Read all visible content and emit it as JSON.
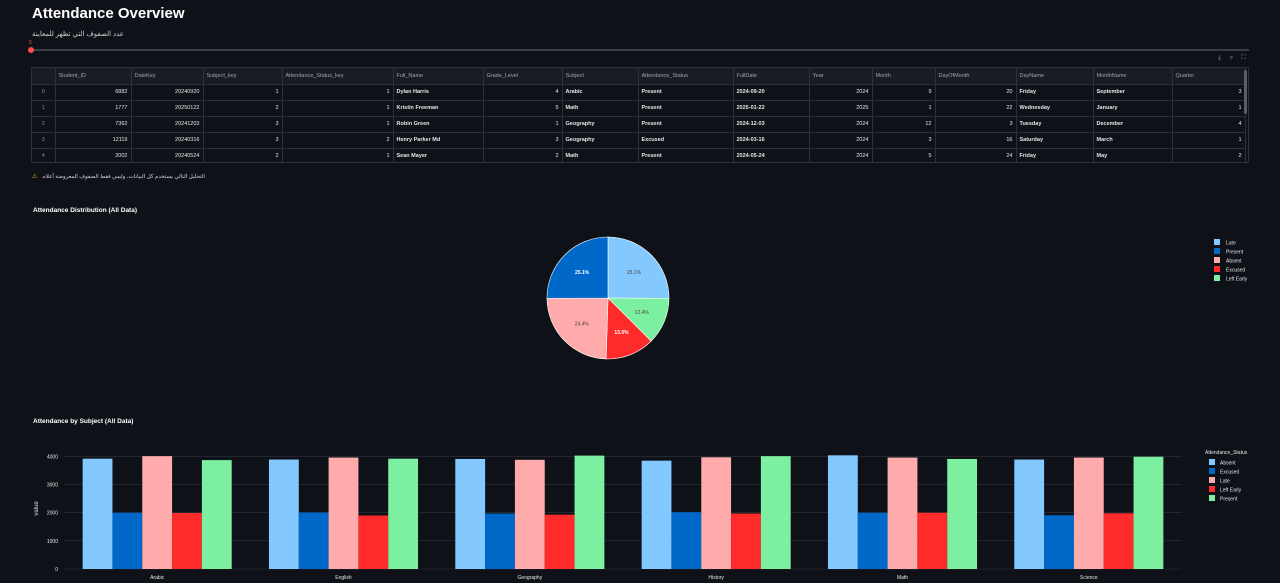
{
  "page": {
    "title": "Attendance Overview"
  },
  "slider": {
    "label": "عدد الصفوف التي تظهر للمعاينة",
    "value": "5"
  },
  "toolbar": {
    "download_icon": "download-icon",
    "search_icon": "search-icon",
    "fullscreen_icon": "fullscreen-icon"
  },
  "table": {
    "columns": [
      "",
      "Student_ID",
      "DateKey",
      "Subject_key",
      "Attendance_Status_key",
      "Full_Name",
      "Grade_Level",
      "Subject",
      "Attendance_Status",
      "FullDate",
      "Year",
      "Month",
      "DayOfMonth",
      "DayName",
      "MonthName",
      "Quarter"
    ],
    "rows": [
      [
        "0",
        "6882",
        "20240920",
        "1",
        "1",
        "Dylan Harris",
        "4",
        "Arabic",
        "Present",
        "2024-09-20",
        "2024",
        "9",
        "20",
        "Friday",
        "September",
        "3"
      ],
      [
        "1",
        "1777",
        "20250122",
        "2",
        "1",
        "Kristin Freeman",
        "5",
        "Math",
        "Present",
        "2025-01-22",
        "2025",
        "1",
        "22",
        "Wednesday",
        "January",
        "1"
      ],
      [
        "2",
        "7362",
        "20241203",
        "3",
        "1",
        "Robin Green",
        "1",
        "Geography",
        "Present",
        "2024-12-03",
        "2024",
        "12",
        "3",
        "Tuesday",
        "December",
        "4"
      ],
      [
        "3",
        "12119",
        "20240316",
        "3",
        "2",
        "Henry Parker Md",
        "3",
        "Geography",
        "Excused",
        "2024-03-16",
        "2024",
        "3",
        "16",
        "Saturday",
        "March",
        "1"
      ],
      [
        "4",
        "2002",
        "20240524",
        "2",
        "1",
        "Sean Mayer",
        "2",
        "Math",
        "Present",
        "2024-05-24",
        "2024",
        "5",
        "24",
        "Friday",
        "May",
        "2"
      ]
    ]
  },
  "warning": {
    "text": "التحليل التالي يستخدم كل البيانات، وليس فقط الصفوف المعروضة أعلاه."
  },
  "colors": {
    "Late": "#83c9ff",
    "Present": "#0068c9",
    "Absent": "#ffabab",
    "Excused": "#ff2b2b",
    "Left Early": "#7defa1"
  },
  "pie_title": "Attendance Distribution (All Data)",
  "bar_title": "Attendance by Subject (All Data)",
  "chart_data": [
    {
      "type": "pie",
      "title": "Attendance Distribution (All Data)",
      "slices": [
        {
          "label": "Late",
          "value": 25.1,
          "text": "25.1%"
        },
        {
          "label": "Left Early",
          "value": 12.4,
          "text": "12.4%"
        },
        {
          "label": "Excused",
          "value": 13.0,
          "text": "13.0%"
        },
        {
          "label": "Absent",
          "value": 24.4,
          "text": "24.4%"
        },
        {
          "label": "Present",
          "value": 25.1,
          "text": "25.1%"
        }
      ],
      "legend": [
        "Late",
        "Present",
        "Absent",
        "Excused",
        "Left Early"
      ],
      "legend_position": "right"
    },
    {
      "type": "bar",
      "title": "Attendance by Subject (All Data)",
      "categories": [
        "Arabic",
        "English",
        "Geography",
        "History",
        "Math",
        "Science"
      ],
      "series": [
        {
          "name": "Absent",
          "color_key": "Late",
          "values": [
            3920,
            3890,
            3910,
            3850,
            4040,
            3890
          ]
        },
        {
          "name": "Excused",
          "color_key": "Present",
          "values": [
            2000,
            2010,
            1970,
            2020,
            2000,
            1910
          ]
        },
        {
          "name": "Late",
          "color_key": "Absent",
          "values": [
            4010,
            3960,
            3880,
            3970,
            3960,
            3960
          ]
        },
        {
          "name": "Left Early",
          "color_key": "Excused",
          "values": [
            1990,
            1900,
            1930,
            1970,
            2000,
            1980
          ]
        },
        {
          "name": "Present",
          "color_key": "Left Early",
          "values": [
            3870,
            3920,
            4030,
            4010,
            3910,
            3990
          ]
        }
      ],
      "ylabel": "value",
      "ylim": [
        0,
        4300
      ],
      "yticks": [
        0,
        1000,
        2000,
        3000,
        4000
      ],
      "legend_title": "Attendance_Status",
      "legend_position": "right",
      "grid": true
    }
  ]
}
